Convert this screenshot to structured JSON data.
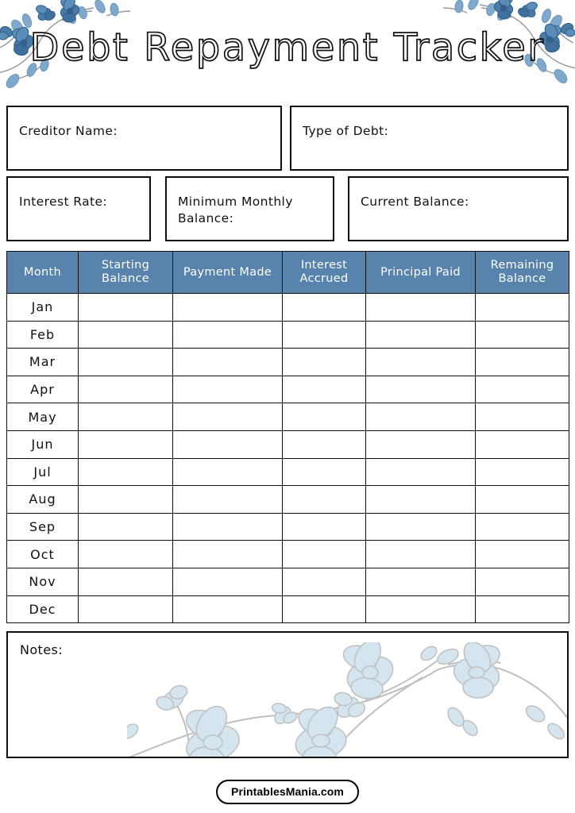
{
  "page": {
    "title": "Debt Repayment Tracker"
  },
  "colors": {
    "table_header_bg": "#5783ad",
    "table_header_text": "#ffffff",
    "border": "#111111",
    "floral_blue": "#4a7ba8",
    "floral_watermark": "#d5e5f0",
    "stem_gray": "#9a9a9a"
  },
  "fields": {
    "row1": [
      {
        "label": "Creditor Name:",
        "value": ""
      },
      {
        "label": "Type of Debt:",
        "value": ""
      }
    ],
    "row2": [
      {
        "label": "Interest Rate:",
        "value": ""
      },
      {
        "label": "Minimum Monthly Balance:",
        "value": ""
      },
      {
        "label": "Current Balance:",
        "value": ""
      }
    ]
  },
  "table": {
    "columns": [
      "Month",
      "Starting Balance",
      "Payment Made",
      "Interest Accrued",
      "Principal Paid",
      "Remaining Balance"
    ],
    "rows": [
      {
        "month": "Jan",
        "starting_balance": "",
        "payment_made": "",
        "interest_accrued": "",
        "principal_paid": "",
        "remaining_balance": ""
      },
      {
        "month": "Feb",
        "starting_balance": "",
        "payment_made": "",
        "interest_accrued": "",
        "principal_paid": "",
        "remaining_balance": ""
      },
      {
        "month": "Mar",
        "starting_balance": "",
        "payment_made": "",
        "interest_accrued": "",
        "principal_paid": "",
        "remaining_balance": ""
      },
      {
        "month": "Apr",
        "starting_balance": "",
        "payment_made": "",
        "interest_accrued": "",
        "principal_paid": "",
        "remaining_balance": ""
      },
      {
        "month": "May",
        "starting_balance": "",
        "payment_made": "",
        "interest_accrued": "",
        "principal_paid": "",
        "remaining_balance": ""
      },
      {
        "month": "Jun",
        "starting_balance": "",
        "payment_made": "",
        "interest_accrued": "",
        "principal_paid": "",
        "remaining_balance": ""
      },
      {
        "month": "Jul",
        "starting_balance": "",
        "payment_made": "",
        "interest_accrued": "",
        "principal_paid": "",
        "remaining_balance": ""
      },
      {
        "month": "Aug",
        "starting_balance": "",
        "payment_made": "",
        "interest_accrued": "",
        "principal_paid": "",
        "remaining_balance": ""
      },
      {
        "month": "Sep",
        "starting_balance": "",
        "payment_made": "",
        "interest_accrued": "",
        "principal_paid": "",
        "remaining_balance": ""
      },
      {
        "month": "Oct",
        "starting_balance": "",
        "payment_made": "",
        "interest_accrued": "",
        "principal_paid": "",
        "remaining_balance": ""
      },
      {
        "month": "Nov",
        "starting_balance": "",
        "payment_made": "",
        "interest_accrued": "",
        "principal_paid": "",
        "remaining_balance": ""
      },
      {
        "month": "Dec",
        "starting_balance": "",
        "payment_made": "",
        "interest_accrued": "",
        "principal_paid": "",
        "remaining_balance": ""
      }
    ]
  },
  "notes": {
    "label": "Notes:",
    "value": ""
  },
  "footer": {
    "brand": "PrintablesMania.com"
  },
  "decorations": {
    "header_left": "floral-branch-icon",
    "header_right": "floral-branch-icon",
    "notes_watermark": "floral-watermark-icon"
  }
}
